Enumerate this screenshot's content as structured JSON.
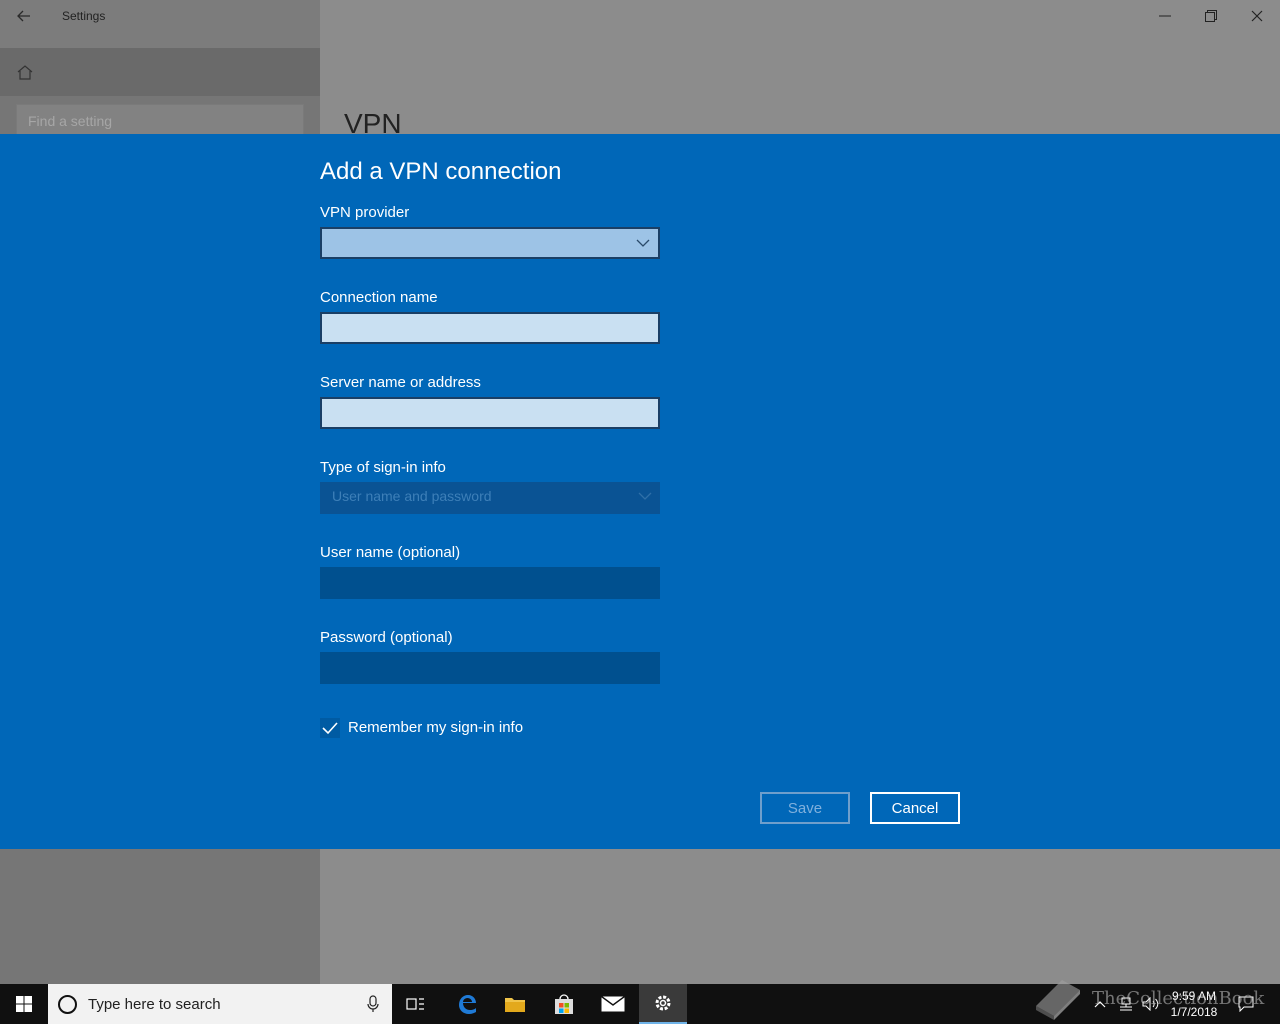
{
  "window": {
    "title": "Settings",
    "controls": {
      "minimize": "–",
      "restore": "❐",
      "close": "✕"
    }
  },
  "sidebar": {
    "search_placeholder": "Find a setting"
  },
  "main": {
    "heading": "VPN"
  },
  "dialog": {
    "title": "Add a VPN connection",
    "fields": {
      "provider": {
        "label": "VPN provider",
        "value": ""
      },
      "connection_name": {
        "label": "Connection name",
        "value": ""
      },
      "server": {
        "label": "Server name or address",
        "value": ""
      },
      "signin_type": {
        "label": "Type of sign-in info",
        "value": "User name and password"
      },
      "username": {
        "label": "User name (optional)",
        "value": ""
      },
      "password": {
        "label": "Password (optional)",
        "value": ""
      }
    },
    "remember": {
      "label": "Remember my sign-in info",
      "checked": true
    },
    "buttons": {
      "save": "Save",
      "cancel": "Cancel"
    }
  },
  "taskbar": {
    "search_placeholder": "Type here to search",
    "clock": {
      "time": "9:59 AM",
      "date": "1/7/2018"
    }
  },
  "watermark": {
    "text": "TheCollectionBook"
  },
  "colors": {
    "dialog_bg": "#0067b8",
    "accent": "#6fb3e8",
    "taskbar": "#101010"
  }
}
